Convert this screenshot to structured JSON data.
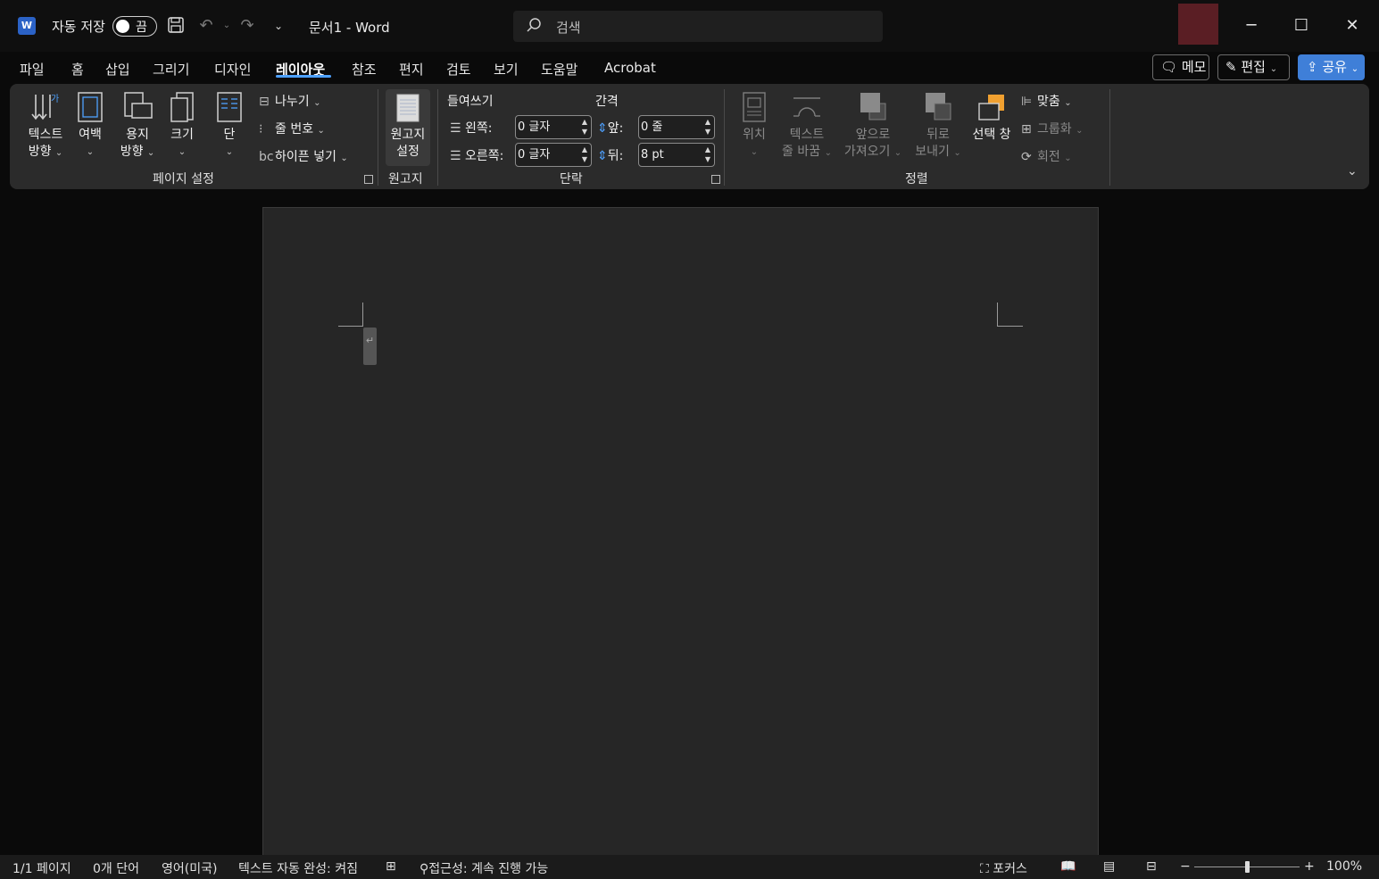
{
  "titlebar": {
    "app_icon": "word-icon",
    "app_letter": "W",
    "autosave_label": "자동 저장",
    "autosave_state": "끔",
    "doc_title": "문서1  -  Word",
    "search_placeholder": "검색",
    "icons": [
      "save-icon",
      "undo-icon",
      "redo-icon",
      "customize-icon"
    ]
  },
  "tabs": [
    "파일",
    "홈",
    "삽입",
    "그리기",
    "디자인",
    "레이아웃",
    "참조",
    "편지",
    "검토",
    "보기",
    "도움말",
    "Acrobat"
  ],
  "active_tab": "레이아웃",
  "header_buttons": {
    "comments": "메모",
    "editing": "편집",
    "share": "공유"
  },
  "ribbon": {
    "page_setup": {
      "label": "페이지 설정",
      "text_direction": [
        "텍스트",
        "방향"
      ],
      "margins": "여백",
      "orientation": [
        "용지",
        "방향"
      ],
      "size": "크기",
      "columns": "단",
      "breaks": "나누기",
      "line_numbers": "줄 번호",
      "hyphenation": "하이픈 넣기"
    },
    "manuscript": {
      "label": "원고지",
      "button": [
        "원고지",
        "설정"
      ]
    },
    "paragraph": {
      "label": "단락",
      "indent_heading": "들여쓰기",
      "spacing_heading": "간격",
      "left_label": "왼쪽:",
      "left_value": "0 글자",
      "right_label": "오른쪽:",
      "right_value": "0 글자",
      "before_label": "앞:",
      "before_value": "0 줄",
      "after_label": "뒤:",
      "after_value": "8 pt"
    },
    "arrange": {
      "label": "정렬",
      "position": "위치",
      "wrap_text": [
        "텍스트",
        "줄 바꿈"
      ],
      "bring_forward": [
        "앞으로",
        "가져오기"
      ],
      "send_backward": [
        "뒤로",
        "보내기"
      ],
      "selection_pane": "선택 창",
      "align": "맞춤",
      "group": "그룹화",
      "rotate": "회전"
    }
  },
  "statusbar": {
    "page": "1/1 페이지",
    "words": "0개 단어",
    "language": "영어(미국)",
    "text_predictions": "텍스트 자동 완성: 켜짐",
    "accessibility": "접근성: 계속 진행 가능",
    "focus": "포커스",
    "zoom": "100%",
    "zoom_minus": "−",
    "zoom_plus": "+"
  },
  "colors": {
    "accent": "#4ea1ff",
    "share": "#3f7fd8",
    "avatar": "#5a1e24",
    "page": "#262626",
    "ribbon": "#2b2b2b"
  }
}
